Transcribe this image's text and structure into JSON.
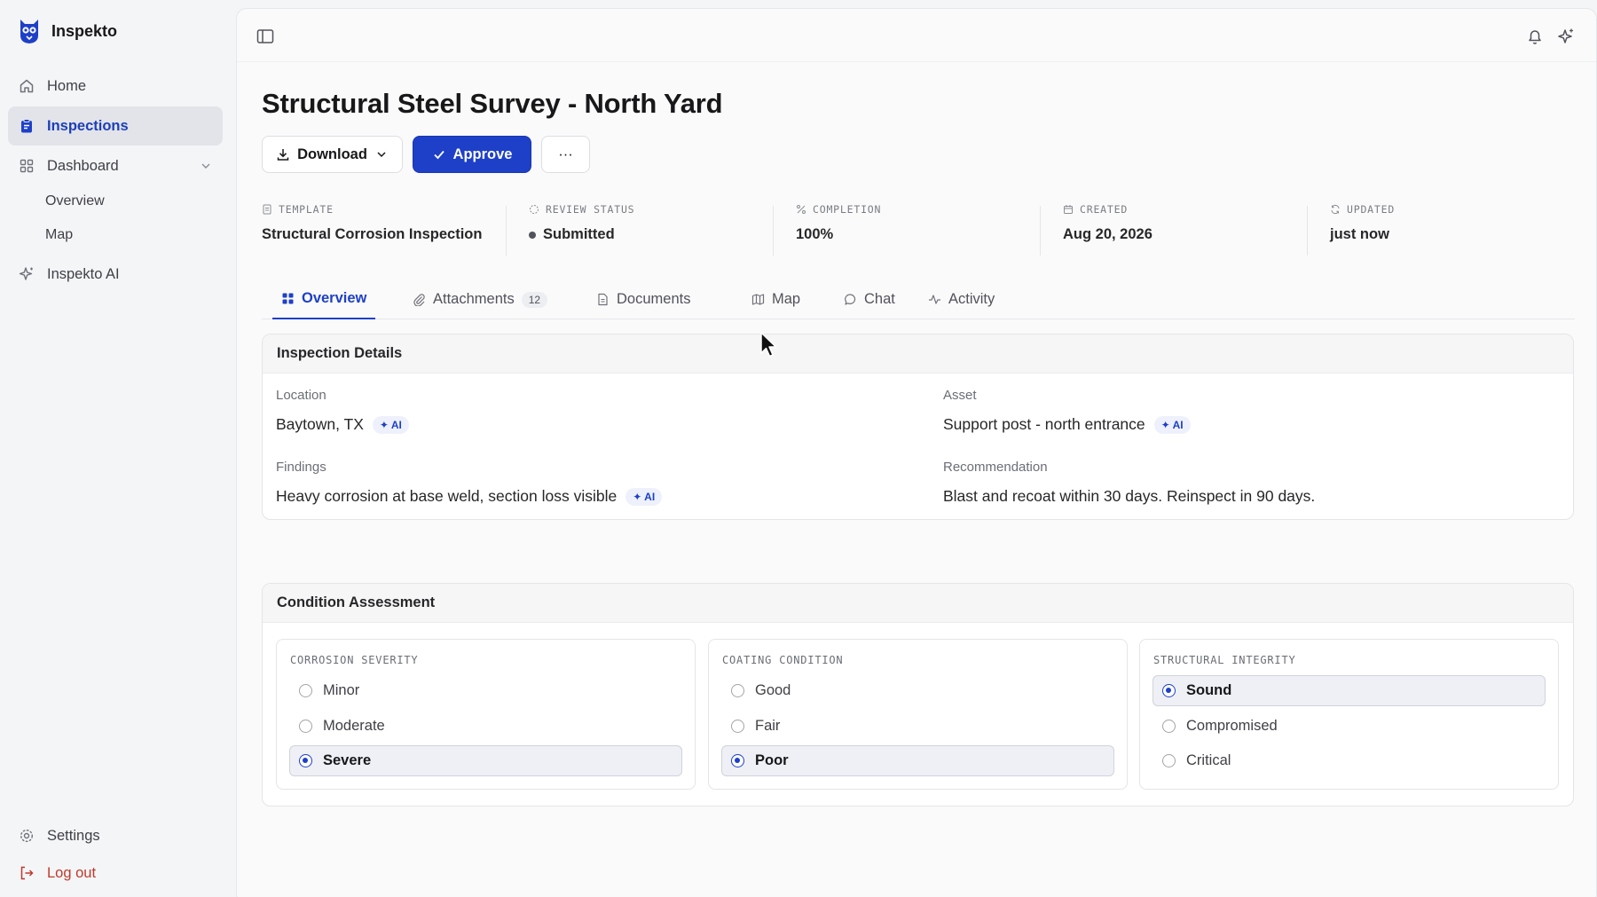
{
  "app": {
    "name": "Inspekto",
    "brand_color": "#1e40c8"
  },
  "sidebar": {
    "home": "Home",
    "inspections": "Inspections",
    "dashboard": "Dashboard",
    "dashboard_children": [
      "Overview",
      "Map"
    ],
    "ai": "Inspekto AI",
    "settings": "Settings",
    "logout": "Log out"
  },
  "page": {
    "title": "Structural Steel Survey - North Yard"
  },
  "actions": {
    "download": "Download",
    "approve": "Approve",
    "more": "···"
  },
  "meta": {
    "template": {
      "label": "TEMPLATE",
      "value": "Structural Corrosion Inspection"
    },
    "review_status": {
      "label": "REVIEW STATUS",
      "value": "Submitted"
    },
    "completion": {
      "label": "COMPLETION",
      "value": "100%"
    },
    "created": {
      "label": "CREATED",
      "value": "Aug 20, 2026"
    },
    "updated": {
      "label": "UPDATED",
      "value": "just now"
    }
  },
  "tabs": {
    "overview": "Overview",
    "attachments": "Attachments",
    "attachments_count": "12",
    "documents": "Documents",
    "map": "Map",
    "chat": "Chat",
    "activity": "Activity"
  },
  "details": {
    "title": "Inspection Details",
    "ai_tag": "✦ AI",
    "location": {
      "label": "Location",
      "value": "Baytown, TX"
    },
    "asset": {
      "label": "Asset",
      "value": "Support post - north entrance"
    },
    "findings": {
      "label": "Findings",
      "value": "Heavy corrosion at base weld, section loss visible"
    },
    "recommendation": {
      "label": "Recommendation",
      "value": "Blast and recoat within 30 days. Reinspect in 90 days."
    }
  },
  "condition": {
    "title": "Condition Assessment",
    "corrosion": {
      "label": "CORROSION SEVERITY",
      "options": [
        "Minor",
        "Moderate",
        "Severe"
      ],
      "selected": "Severe"
    },
    "coating": {
      "label": "COATING CONDITION",
      "options": [
        "Good",
        "Fair",
        "Poor"
      ],
      "selected": "Poor"
    },
    "integrity": {
      "label": "STRUCTURAL INTEGRITY",
      "options": [
        "Sound",
        "Compromised",
        "Critical"
      ],
      "selected": "Sound"
    }
  }
}
